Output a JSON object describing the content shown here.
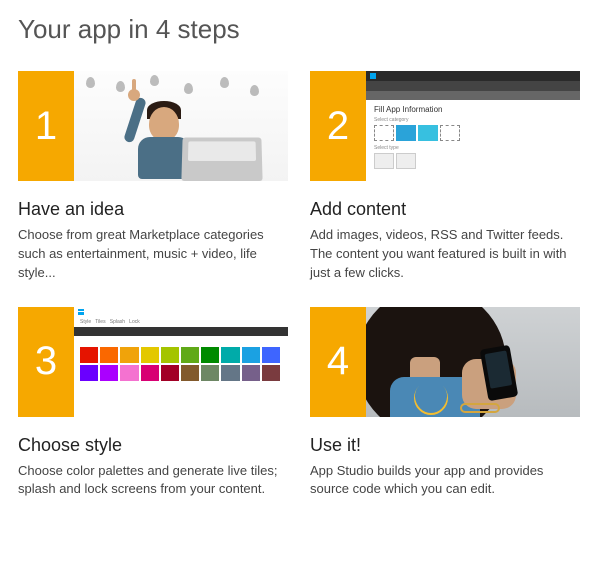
{
  "page": {
    "title": "Your app in 4 steps"
  },
  "steps": [
    {
      "number": "1",
      "title": "Have an idea",
      "desc": "Choose from great Marketplace categories such as entertainment, music + video, life style..."
    },
    {
      "number": "2",
      "title": "Add content",
      "desc": "Add images, videos, RSS and Twitter feeds. The content you want featured is built in with just a few clicks."
    },
    {
      "number": "3",
      "title": "Choose style",
      "desc": "Choose color palettes and generate live tiles; splash and lock screens from your content."
    },
    {
      "number": "4",
      "title": "Use it!",
      "desc": "App Studio builds your app and provides source code which you can edit."
    }
  ],
  "palette_colors": [
    "#e51400",
    "#fa6800",
    "#f0a30a",
    "#e3c800",
    "#a4c400",
    "#60a917",
    "#008a00",
    "#00aba9",
    "#1ba1e2",
    "#3e65ff",
    "#6a00ff",
    "#aa00ff",
    "#f472d0",
    "#d80073",
    "#a20025",
    "#825a2c",
    "#6d8764",
    "#647687",
    "#76608a",
    "#7a3b3f"
  ]
}
